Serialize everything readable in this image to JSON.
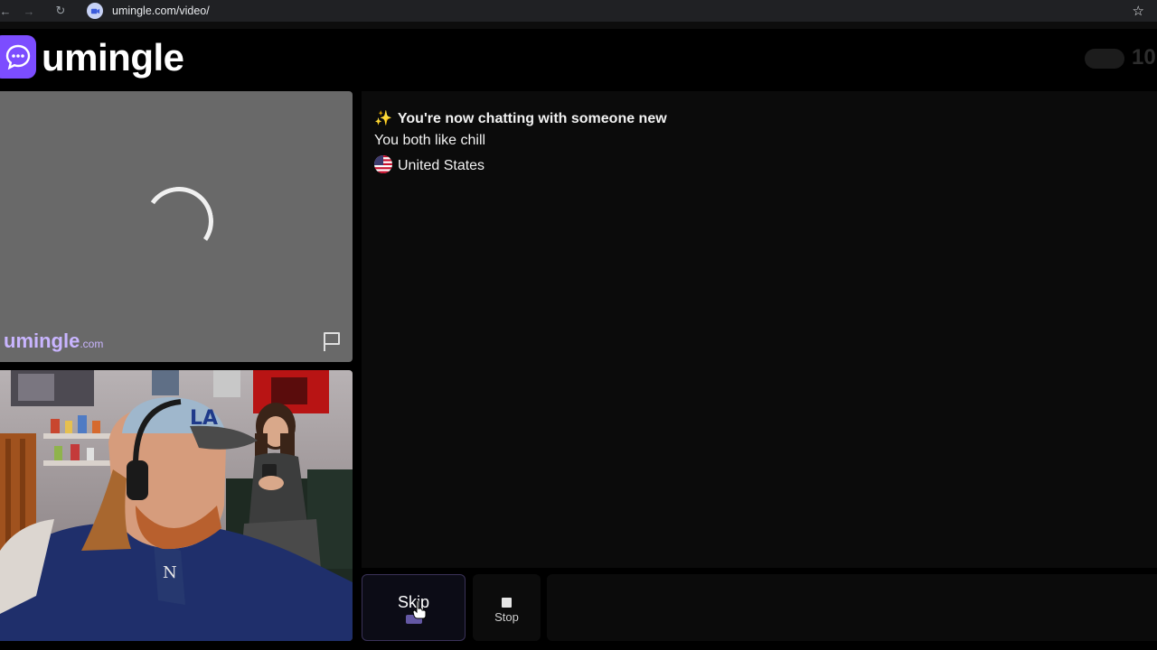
{
  "browser": {
    "url": "umingle.com/video/"
  },
  "header": {
    "logo_text": "umingle",
    "online_count": "10"
  },
  "stranger_video": {
    "watermark": "umingle",
    "watermark_suffix": ".com"
  },
  "chat": {
    "system_message": "You're now chatting with someone new",
    "shared_interest": "You both like chill",
    "country": "United States"
  },
  "controls": {
    "skip_label": "Skip",
    "stop_label": "Stop"
  },
  "colors": {
    "brand": "#7c4dff",
    "watermark": "#c9b5ff"
  }
}
